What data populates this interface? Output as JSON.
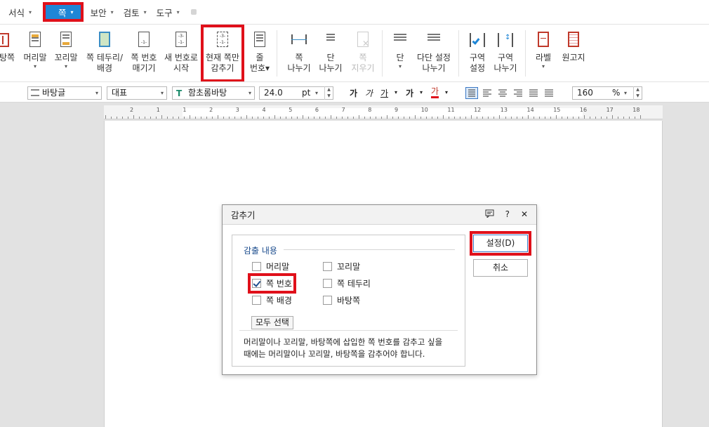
{
  "menubar": {
    "items": [
      {
        "label": "서식"
      },
      {
        "label": "쪽"
      },
      {
        "label": "보안"
      },
      {
        "label": "검토"
      },
      {
        "label": "도구"
      }
    ]
  },
  "ribbon": {
    "buttons": [
      {
        "line1": "탕쪽",
        "line2": ""
      },
      {
        "line1": "머리말",
        "line2": "▾"
      },
      {
        "line1": "꼬리말",
        "line2": "▾"
      },
      {
        "line1": "쪽 테두리/",
        "line2": "배경"
      },
      {
        "line1": "쪽 번호",
        "line2": "매기기"
      },
      {
        "line1": "새 번호로",
        "line2": "시작"
      },
      {
        "line1": "현재 쪽만",
        "line2": "감추기"
      },
      {
        "line1": "줄",
        "line2": "번호▾"
      },
      {
        "line1": "쪽",
        "line2": "나누기"
      },
      {
        "line1": "단",
        "line2": "나누기"
      },
      {
        "line1": "쪽",
        "line2": "지우기"
      },
      {
        "line1": "단",
        "line2": "▾"
      },
      {
        "line1": "다단 설정",
        "line2": "나누기"
      },
      {
        "line1": "구역",
        "line2": "설정"
      },
      {
        "line1": "구역",
        "line2": "나누기"
      },
      {
        "line1": "라벨",
        "line2": "▾"
      },
      {
        "line1": "원고지",
        "line2": ""
      }
    ]
  },
  "format": {
    "style": "바탕글",
    "lang": "대표",
    "font": "함초롬바탕",
    "size": "24.0",
    "unit": "pt",
    "b": "가",
    "i": "가",
    "u": "가",
    "s": "가",
    "color": "가",
    "zoom": "160",
    "zoom_unit": "%"
  },
  "ruler": {
    "numbers": [
      "2",
      "1",
      "1",
      "2",
      "3",
      "4",
      "5",
      "6",
      "7",
      "8",
      "9",
      "10",
      "11",
      "12",
      "13",
      "14",
      "15",
      "16",
      "17",
      "18"
    ]
  },
  "dialog": {
    "title": "감추기",
    "help": "?",
    "close": "✕",
    "group_title": "감출 내용",
    "options": [
      {
        "label": "머리말",
        "checked": false
      },
      {
        "label": "꼬리말",
        "checked": false
      },
      {
        "label": "쪽 번호",
        "checked": true
      },
      {
        "label": "쪽 테두리",
        "checked": false
      },
      {
        "label": "쪽 배경",
        "checked": false
      },
      {
        "label": "바탕쪽",
        "checked": false
      }
    ],
    "select_all": "모두 선택",
    "description_1": "머리말이나 꼬리말, 바탕쪽에 삽입한 쪽 번호를 감추고 싶을",
    "description_2": "때에는 머리말이나 꼬리말, 바탕쪽을 감추어야 합니다.",
    "ok": "설정(D)",
    "cancel": "취소"
  },
  "colors": {
    "accent": "#1f86d6",
    "highlight": "#e0101a",
    "group_title": "#1f4f8f"
  }
}
